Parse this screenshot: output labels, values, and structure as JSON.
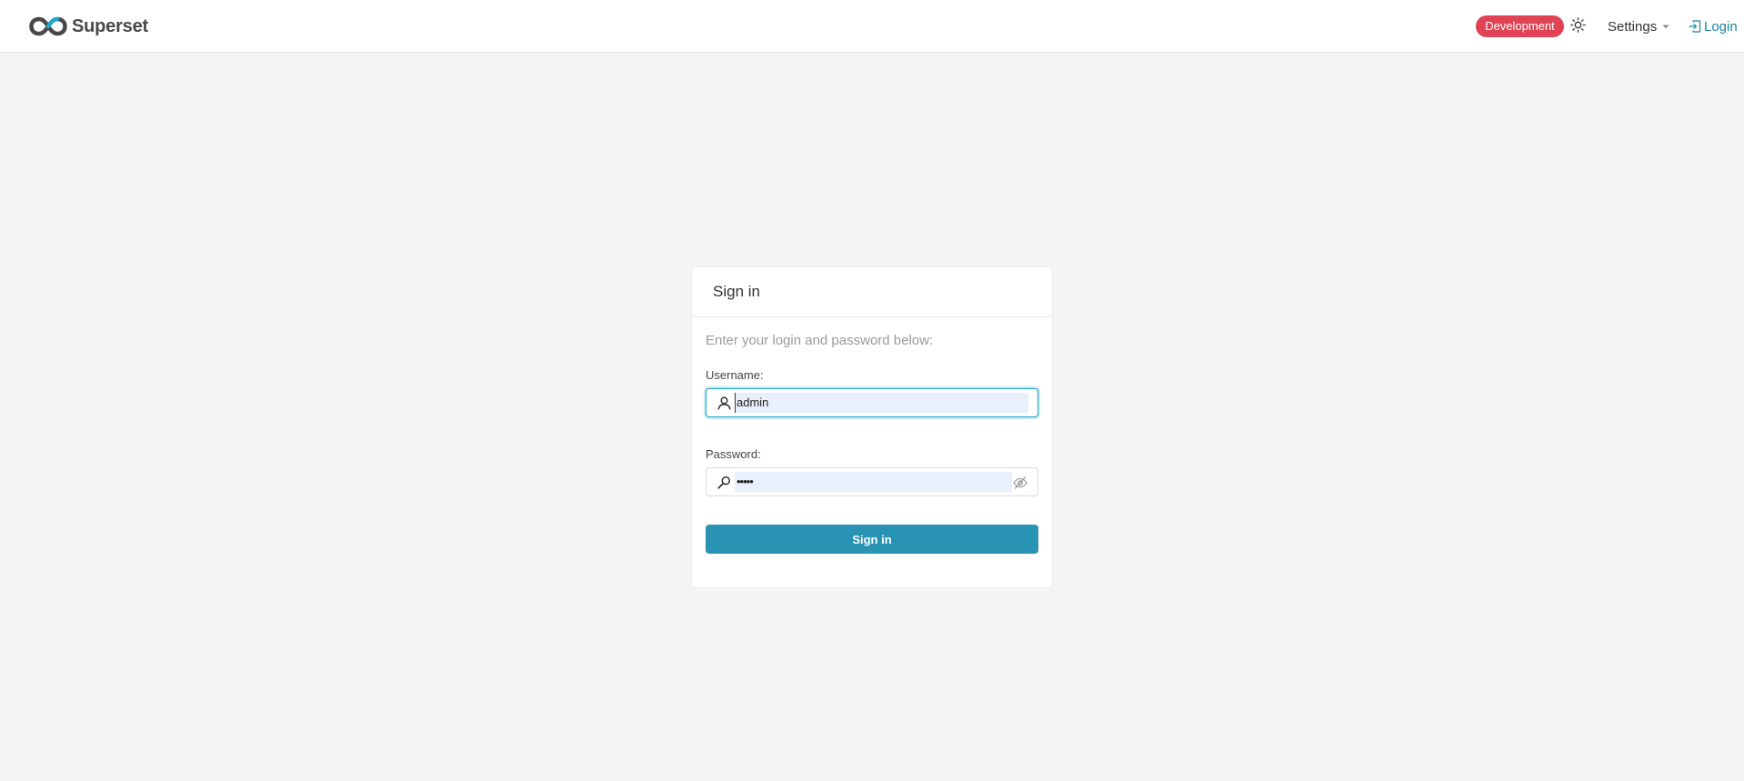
{
  "header": {
    "brand_name": "Superset",
    "environment_badge": "Development",
    "settings_label": "Settings",
    "login_label": "Login",
    "icons": {
      "logo": "superset-logo-icon",
      "theme": "sun-icon",
      "settings_caret": "caret-down-icon",
      "login": "login-icon"
    },
    "colors": {
      "badge": "#e04355",
      "link": "#1a85a0"
    }
  },
  "login_card": {
    "title": "Sign in",
    "subtitle": "Enter your login and password below:",
    "username": {
      "label": "Username:",
      "value": "admin",
      "icon": "user-icon"
    },
    "password": {
      "label": "Password:",
      "masked_value": "•••••",
      "icon": "key-icon",
      "toggle_icon": "eye-invisible-icon"
    },
    "submit_label": "Sign in",
    "colors": {
      "primary": "#2893b3",
      "focus_border": "#20a7c9"
    }
  }
}
